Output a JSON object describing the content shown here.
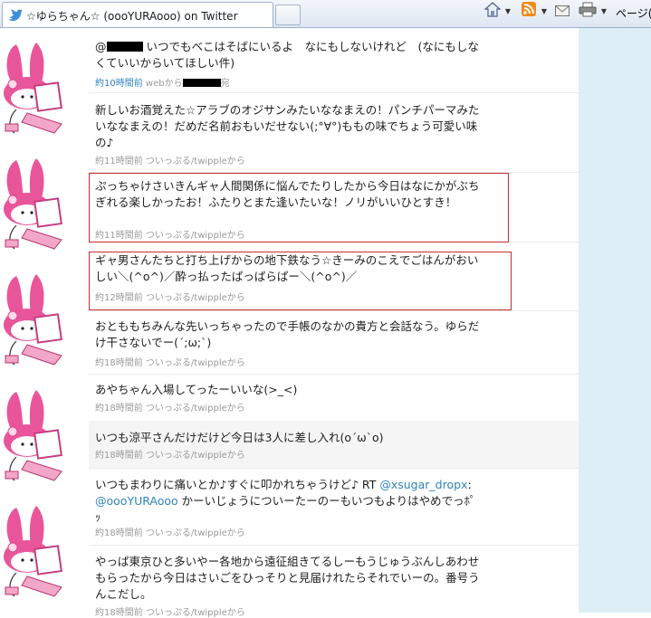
{
  "browser": {
    "tab_title": "☆ゆらちゃん☆ (oooYURAooo) on Twitter",
    "page_menu_label": "ページ(P"
  },
  "tweets": [
    {
      "text_before": "@",
      "text_after": " いつでもベこはそばにいるよ　なにもしないけれど　(なにもしなくていいからいてほしい件)",
      "meta_time": "約10時間前",
      "meta_via": "webから",
      "meta_suffix": "宛"
    },
    {
      "text": "新しいお酒覚えた☆アラブのオジサンみたいななまえの！パンチパーマみたいななまえの！だめだ名前おもいだせない(;°∀°)ももの味でちょう可愛い味の♪",
      "meta": "約11時間前 ついっぷる/twippleから"
    },
    {
      "text": "ぷっちゃけさいきんギャ人間関係に悩んでたりしたから今日はなにかがぶちぎれる楽しかったお！ふたりとまた逢いたいな！ノリがいいひとすき！",
      "meta": "約11時間前 ついっぷる/twippleから"
    },
    {
      "text": "ギャ男さんたちと打ち上げからの地下鉄なう☆きーみのこえでごはんがおいしい＼(^o^)／酔っ払ったぱっぱらぱー＼(^o^)／",
      "meta": "約12時間前 ついっぷる/twippleから"
    },
    {
      "text": "おとももちみんな先いっちゃったので手帳のなかの貴方と会話なう。ゆらだけ干さないでー(´;ω;`)",
      "meta": "約18時間前 ついっぷる/twippleから"
    },
    {
      "text": "あやちゃん入場してったーいいな(>_<)",
      "meta": "約18時間前 ついっぷる/twippleから"
    },
    {
      "text": "いつも涼平さんだけだけど今日は3人に差し入れ(o´ω`o)",
      "meta": "約18時間前 ついっぷる/twippleから"
    },
    {
      "text_before": "いつもまわりに痛いとか♪すぐに叩かれちゃうけど♪ RT ",
      "mention1": "@xsugar_dropx",
      "text_mid": ":",
      "mention2": "@oooYURAooo",
      "text_after": " かーいじょうについーたーのーもいつもよりはやめでっﾎﾟｯ",
      "meta": "約18時間前 ついっぷる/twippleから"
    },
    {
      "text": "やっぱ東京ひと多いやー各地から遠征組きてるしーもうじゅうぶんしあわせもらったから今日はさいごをひっそりと見届けれたらそれでいーの。番号うんこだし。",
      "meta": "約18時間前 ついっぷる/twippleから"
    }
  ],
  "colors": {
    "link": "#2e83b8",
    "highlight_box": "#c62c2c",
    "sidebar_bg": "#ddeef6"
  }
}
